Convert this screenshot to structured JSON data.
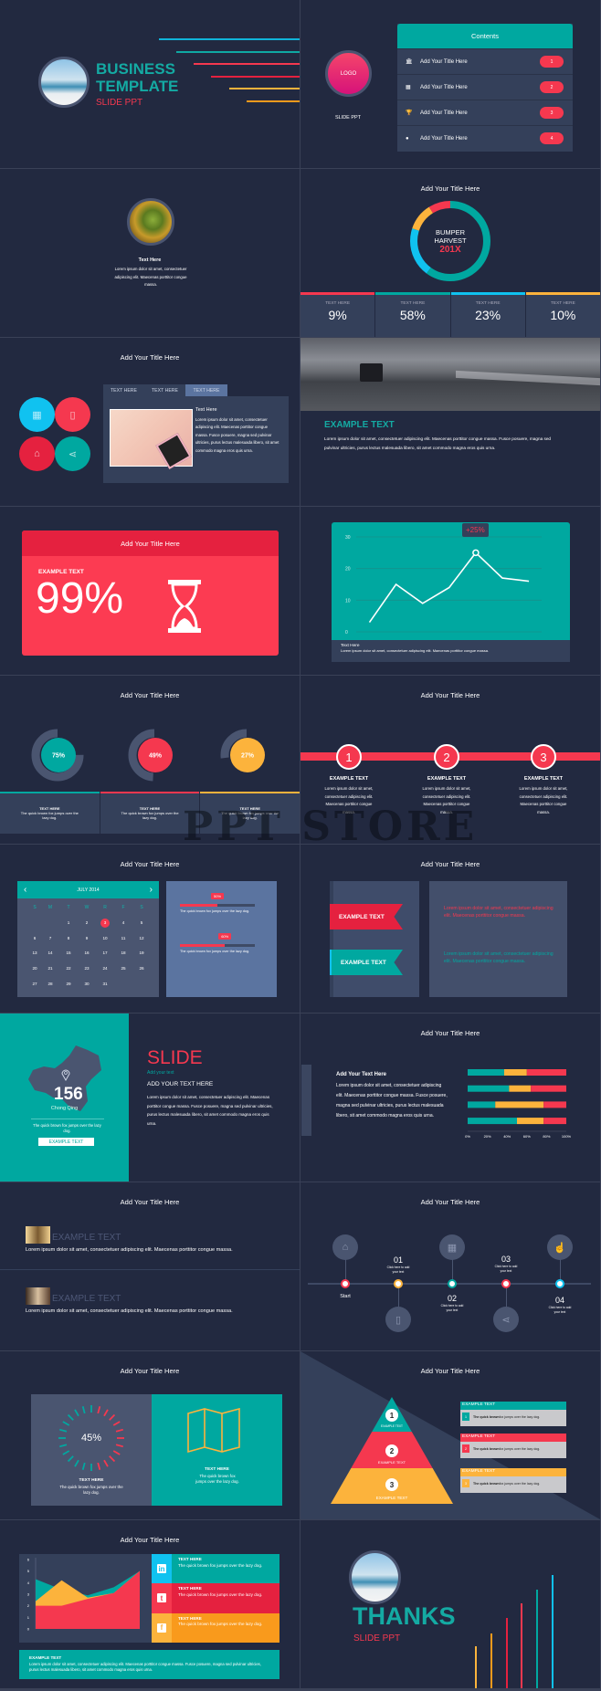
{
  "watermark": "PPT STORE",
  "colors": {
    "teal": "#00a8a0",
    "red": "#f5384f",
    "red_dark": "#e5213f",
    "cyan": "#10c2f0",
    "yellow": "#fcb33c",
    "orange": "#f99a1c",
    "background": "#222940",
    "panel": "#34405a"
  },
  "title_slide": {
    "line1": "BUSINESS",
    "line2": "TEMPLATE",
    "sub": "SLIDE PPT",
    "line_colors": [
      "#10b4d9",
      "#0fa9a3",
      "#f5384f",
      "#e5213f",
      "#fcb33c",
      "#f99a1c"
    ]
  },
  "contents_slide": {
    "logo": "LOGO",
    "sub": "SLIDE PPT",
    "header": "Contents",
    "items": [
      {
        "label": "Add Your Title Here",
        "num": "1",
        "icon": "bank-icon"
      },
      {
        "label": "Add Your Title Here",
        "num": "2",
        "icon": "calendar-icon"
      },
      {
        "label": "Add Your Title Here",
        "num": "3",
        "icon": "trophy-icon"
      },
      {
        "label": "Add Your Title Here",
        "num": "4",
        "icon": "piggy-bank-icon"
      }
    ]
  },
  "profile_slide": {
    "heading": "Text Here",
    "body": "Lorem ipsum dolor sit amet, consectetuer adipiscing elit. Maecenas porttitor congue massa."
  },
  "donut_slide": {
    "title": "Add Your Title Here",
    "center1": "BUMPER",
    "center2": "HARVEST",
    "highlight": "201X",
    "segments": [
      {
        "fraction": 0.6,
        "color": "#00a8a0"
      },
      {
        "fraction": 0.2,
        "color": "#10c2f0"
      },
      {
        "fraction": 0.11,
        "color": "#fcb33c"
      },
      {
        "fraction": 0.09,
        "color": "#f5384f"
      }
    ],
    "stats": [
      {
        "label": "TEXT HERE",
        "value": "9%",
        "color": "#f5384f"
      },
      {
        "label": "TEXT HERE",
        "value": "58%",
        "color": "#00a8a0"
      },
      {
        "label": "TEXT HERE",
        "value": "23%",
        "color": "#10c2f0"
      },
      {
        "label": "TEXT HERE",
        "value": "10%",
        "color": "#fcb33c"
      }
    ]
  },
  "tabs_slide": {
    "title": "Add Your Title Here",
    "tabs": [
      "TEXT HERE",
      "TEXT HERE",
      "TEXT HERE"
    ],
    "active_tab": 2,
    "heading": "Text Here",
    "body": "Lorem ipsum dolor sit amet, consectetuer adipiscing elit. Maecenas porttitor congue massa. Fusce posuere, magna sed pulvinar ultricies, purus lectus malesuada libero, sit amet commodo magna eros quis urna.",
    "icons": [
      "grid-icon",
      "mouse-icon",
      "home-icon",
      "share-icon"
    ]
  },
  "photo_slide": {
    "heading": "EXAMPLE TEXT",
    "body": "Lorem ipsum dolor sit amet, consectetuer adipiscing elit. Maecenas porttitor congue massa. Fusce posuere, magna sed pulvinar ultricies, purus lectus malesuada libero, sit amet commodo magna eros quis urna."
  },
  "percent_slide": {
    "title": "Add Your Title Here",
    "label": "EXAMPLE TEXT",
    "value": "99%",
    "icon": "hourglass-icon"
  },
  "line_slide": {
    "callout": "+25%",
    "footer_title": "Text Here",
    "footer_body": "Lorem ipsum dolor sit amet, consectetuer adipiscing elit. Maecenas porttitor congue massa.",
    "chart_data": {
      "type": "line",
      "values": [
        3,
        15,
        9,
        14,
        25,
        17,
        16
      ],
      "yticks": [
        "0",
        "10",
        "20",
        "30"
      ],
      "ylim": [
        0,
        30
      ],
      "grid": true
    }
  },
  "rings_slide": {
    "title": "Add Your Title Here",
    "rings": [
      {
        "value": "75%",
        "fraction": 0.75,
        "color": "#00a8a0"
      },
      {
        "value": "49%",
        "fraction": 0.49,
        "color": "#f5384f"
      },
      {
        "value": "27%",
        "fraction": 0.27,
        "color": "#fcb33c"
      }
    ],
    "boxes": [
      {
        "title": "TEXT HERE",
        "body": "The quick brown fox jumps over the lazy dog."
      },
      {
        "title": "TEXT HERE",
        "body": "The quick brown fox jumps over the lazy dog."
      },
      {
        "title": "TEXT HERE",
        "body": "The quick brown fox jumps over the lazy dog."
      }
    ]
  },
  "steps_slide": {
    "title": "Add Your Title Here",
    "steps": [
      {
        "num": "1",
        "heading": "EXAMPLE TEXT",
        "body": "Lorem ipsum dolor sit amet, consectetuer adipiscing elit. Maecenas porttitor congue massa."
      },
      {
        "num": "2",
        "heading": "EXAMPLE TEXT",
        "body": "Lorem ipsum dolor sit amet, consectetuer adipiscing elit. Maecenas porttitor congue massa."
      },
      {
        "num": "3",
        "heading": "EXAMPLE TEXT",
        "body": "Lorem ipsum dolor sit amet, consectetuer adipiscing elit. Maecenas porttitor congue massa."
      }
    ]
  },
  "calendar_slide": {
    "title": "Add Your Title Here",
    "month": "JULY 2014",
    "weekdays": [
      "S",
      "M",
      "T",
      "W",
      "R",
      "F",
      "S"
    ],
    "days": [
      "1",
      "2",
      "3",
      "4",
      "5",
      "6",
      "7",
      "8",
      "9",
      "10",
      "11",
      "12",
      "13",
      "14",
      "15",
      "16",
      "17",
      "18",
      "19",
      "20",
      "21",
      "22",
      "23",
      "24",
      "25",
      "26",
      "27",
      "28",
      "29",
      "30",
      "31"
    ],
    "selected": "3",
    "progress": [
      {
        "value": "50%",
        "fraction": 0.5,
        "text": "The quick brown fox jumps over the lazy dog."
      },
      {
        "value": "60%",
        "fraction": 0.6,
        "text": "The quick brown fox jumps over the lazy dog."
      }
    ]
  },
  "ribbon_slide": {
    "title": "Add Your Title Here",
    "ribbons": [
      "EXAMPLE TEXT",
      "EXAMPLE TEXT"
    ],
    "texts": [
      "Lorem ipsum dolor sit amet, consectetuer adipiscing elit. Maecenas porttitor congue massa.",
      "Lorem ipsum dolor sit amet, consectetuer adipiscing elit. Maecenas porttitor congue massa."
    ]
  },
  "map_slide": {
    "number": "156",
    "city": "Chong Qing",
    "caption": "The quick brown fox jumps over the lazy dog.",
    "button": "EXAMPLE TEXT",
    "headline": "SLIDE",
    "tagline": "Add your text",
    "subhead": "ADD YOUR TEXT HERE",
    "body": "Lorem ipsum dolor sit amet, consectetuer adipiscing elit. Maecenas porttitor congue massa. Fusce posuere, magna sed pulvinar ultricies, purus lectus malesuada libero, sit amet commodo magna eros quis urna."
  },
  "bars_slide": {
    "title": "Add Your Title Here",
    "heading": "Add Your Text Here",
    "body": "Lorem ipsum dolor sit amet, consectetuer adipiscing elit. Maecenas porttitor congue massa. Fusce posuere, magna sed pulvinar ultricies, purus lectus malesuada libero, sit amet commodo magna eros quis urna.",
    "chart_data": {
      "type": "bar",
      "orientation": "horizontal-stacked",
      "xticks": [
        "0%",
        "20%",
        "40%",
        "60%",
        "80%",
        "100%"
      ],
      "rows": [
        [
          37,
          23,
          40
        ],
        [
          42,
          22,
          36
        ],
        [
          28,
          49,
          23
        ],
        [
          50,
          27,
          23
        ]
      ],
      "series_colors": [
        "#00a8a0",
        "#fcb33c",
        "#f5384f"
      ]
    }
  },
  "list_slide": {
    "title": "Add Your Title Here",
    "items": [
      {
        "heading": "EXAMPLE TEXT",
        "body": "Lorem ipsum dolor sit amet, consectetuer adipiscing elit. Maecenas porttitor congue massa."
      },
      {
        "heading": "EXAMPLE TEXT",
        "body": "Lorem ipsum dolor sit amet, consectetuer adipiscing elit. Maecenas porttitor congue massa."
      }
    ]
  },
  "timeline_slide": {
    "title": "Add Your Title Here",
    "start": "Start",
    "points": [
      {
        "num": "01",
        "text": "Click here to add your text",
        "color": "#fcb33c"
      },
      {
        "num": "02",
        "text": "Click here to add your text",
        "color": "#00a8a0"
      },
      {
        "num": "03",
        "text": "Click here to add your text",
        "color": "#f5384f"
      },
      {
        "num": "04",
        "text": "Click here to add your text",
        "color": "#10c2f0"
      }
    ],
    "icons": [
      "home-icon",
      "mouse-icon",
      "grid-icon",
      "share-icon",
      "hand-pointer-icon"
    ]
  },
  "gauge_slide": {
    "title": "Add Your Title Here",
    "value": "45%",
    "fraction": 0.45,
    "left_title": "TEXT HERE",
    "left_body": "The quick brown fox jumps over the lazy dog.",
    "right_title": "TEXT HERE",
    "right_body": "The quick brown fox jumps over the lazy dog.",
    "icon": "map-icon"
  },
  "pyramid_slide": {
    "title": "Add Your Title Here",
    "levels": [
      {
        "num": "1",
        "label": "EXAMPLE TEXT",
        "color": "#00a8a0"
      },
      {
        "num": "2",
        "label": "EXAMPLE TEXT",
        "color": "#f5384f"
      },
      {
        "num": "3",
        "label": "EXAMPLE TEXT",
        "color": "#fcb33c"
      }
    ],
    "cards": [
      {
        "heading": "EXAMPLE TEXT",
        "num": "1",
        "bold": "The quick brown",
        "rest": " fox jumps over the lazy dog."
      },
      {
        "heading": "EXAMPLE TEXT",
        "num": "2",
        "bold": "The quick brown",
        "rest": " fox jumps over the lazy dog."
      },
      {
        "heading": "EXAMPLE TEXT",
        "num": "3",
        "bold": "The quick brown",
        "rest": " fox jumps over the lazy dog."
      }
    ]
  },
  "area_slide": {
    "title": "Add Your Title Here",
    "chart_data": {
      "type": "area",
      "yticks": [
        "0",
        "1",
        "2",
        "3",
        "4",
        "5",
        "6"
      ],
      "ylim": [
        0,
        6
      ],
      "series": [
        {
          "color": "#00a8a0",
          "values": [
            4.3,
            3.4,
            2.9,
            3.6,
            5
          ]
        },
        {
          "color": "#fcb33c",
          "values": [
            2.4,
            4.2,
            2.7,
            3.1,
            5
          ]
        },
        {
          "color": "#f5384f",
          "values": [
            2,
            2,
            2.6,
            3.1,
            5
          ]
        }
      ]
    },
    "social": [
      {
        "icon": "linkedin-icon",
        "title": "TEXT HERE",
        "body": "The quick brown fox jumps over the lazy dog."
      },
      {
        "icon": "twitter-icon",
        "title": "TEXT HERE",
        "body": "The quick brown fox jumps over the lazy dog."
      },
      {
        "icon": "facebook-icon",
        "title": "TEXT HERE",
        "body": "The quick brown fox jumps over the lazy dog."
      }
    ],
    "footer_title": "EXAMPLE TEXT",
    "footer_body": "Lorem ipsum dolor sit amet, consectetuer adipiscing elit. Maecenas porttitor congue massa. Fusce posuere, magna sed pulvinar ultricies, purus lectus malesuada libero, sit amet commodo magna eros quis urna."
  },
  "thanks_slide": {
    "headline": "THANKS",
    "sub": "SLIDE PPT"
  }
}
